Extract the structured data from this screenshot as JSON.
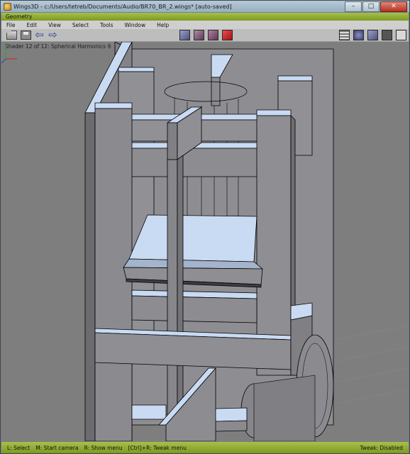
{
  "window": {
    "app_name": "Wings3D",
    "title": "Wings3D - c:/Users/tetreb/Documents/Audio/BR70_BR_2.wings* [auto-saved]",
    "controls": {
      "minimize": "–",
      "maximize": "□",
      "close": "✕"
    }
  },
  "geometry_header": "Geometry",
  "menu": [
    "File",
    "Edit",
    "View",
    "Select",
    "Tools",
    "Window",
    "Help"
  ],
  "toolbar": {
    "left_icons": [
      "folder-open-icon",
      "save-icon",
      "undo-arrow-icon",
      "redo-arrow-icon"
    ],
    "selection_modes": [
      "vertex-mode-icon",
      "edge-mode-icon",
      "face-mode-icon",
      "body-mode-icon"
    ],
    "view_icons": [
      "wireframe-icon",
      "smooth-shade-icon",
      "flat-shade-icon",
      "dark-background-icon",
      "light-background-icon"
    ],
    "active_mode": "body"
  },
  "viewport": {
    "shader_info": "Shader 12 of 12: Spherical Harmonics 9",
    "background_color": "#7e7e7e",
    "model_colors": {
      "face_light": "#c9dbf3",
      "face_mid": "#8f8f93",
      "face_dark": "#6b6b70",
      "edge": "#000000"
    }
  },
  "statusbar": {
    "select_hint": "L: Select",
    "camera_hint": "M: Start camera",
    "menu_hint": "R: Show menu",
    "tweak_hint": "[Ctrl]+R: Tweak menu",
    "tweak_status": "Tweak: Disabled"
  }
}
